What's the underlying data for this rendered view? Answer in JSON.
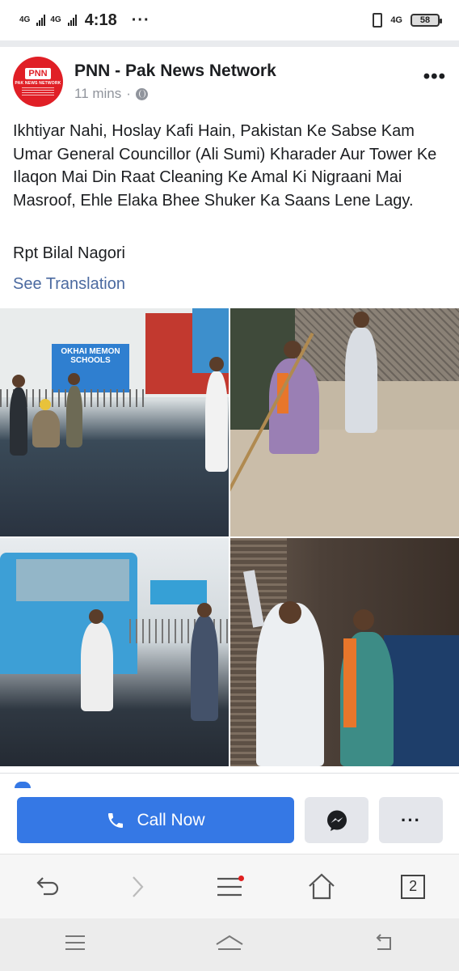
{
  "status_bar": {
    "network_1": "4G",
    "network_2": "4G",
    "time": "4:18",
    "notif": "···",
    "net_right": "4G",
    "battery": "58"
  },
  "post": {
    "page_name": "PNN - Pak News Network",
    "avatar_logo": "PNN",
    "avatar_sub": "PAK NEWS NETWORK",
    "time_ago": "11 mins",
    "separator": "·",
    "body": "Ikhtiyar Nahi, Hoslay Kafi Hain, Pakistan Ke Sabse Kam Umar General Councillor (Ali Sumi) Kharader Aur Tower Ke Ilaqon Mai Din Raat Cleaning Ke Amal Ki Nigraani Mai Masroof, Ehle Elaka Bhee Shuker Ka Saans Lene Lagy.",
    "reporter": "Rpt Bilal Nagori",
    "see_translation": "See Translation",
    "photo1_sign": "OKHAI MEMON SCHOOLS"
  },
  "action_bar": {
    "call_label": "Call Now",
    "more_label": "···"
  },
  "browser_nav": {
    "tab_count": "2"
  }
}
